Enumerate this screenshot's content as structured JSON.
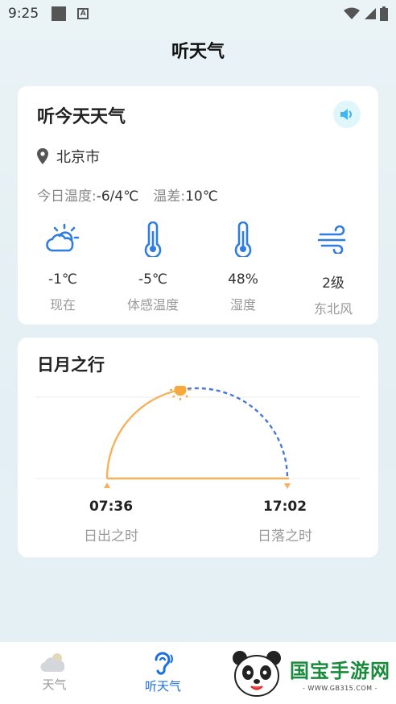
{
  "status_bar": {
    "time": "9:25",
    "a_icon_text": "A"
  },
  "app": {
    "title": "听天气"
  },
  "weather_card": {
    "title": "听今天天气",
    "location": "北京市",
    "temp_range_label": "今日温度:",
    "temp_range_value": "-6/4℃",
    "temp_diff_label": "温差:",
    "temp_diff_value": "10℃",
    "metrics": [
      {
        "icon": "cloud-sun-icon",
        "value": "-1℃",
        "label": "现在"
      },
      {
        "icon": "thermometer-icon",
        "value": "-5℃",
        "label": "体感温度"
      },
      {
        "icon": "thermometer-icon",
        "value": "48%",
        "label": "湿度"
      },
      {
        "icon": "wind-icon",
        "value": "2级",
        "label": "东北风"
      }
    ]
  },
  "sun_card": {
    "title": "日月之行",
    "sunrise_time": "07:36",
    "sunrise_label": "日出之时",
    "sunset_time": "17:02",
    "sunset_label": "日落之时",
    "day_progress": 0.44
  },
  "tabs": [
    {
      "label": "天气",
      "icon": "weather-cloud-icon",
      "active": false
    },
    {
      "label": "听天气",
      "icon": "ear-icon",
      "active": true
    }
  ],
  "watermark": {
    "title": "国宝手游网",
    "url": "- WWW.GB315.COM -"
  },
  "colors": {
    "accent": "#1a6fe0",
    "sun_arc": "#f5b25a",
    "sun_dash": "#4a78d8",
    "sun": "#f7a93b"
  }
}
